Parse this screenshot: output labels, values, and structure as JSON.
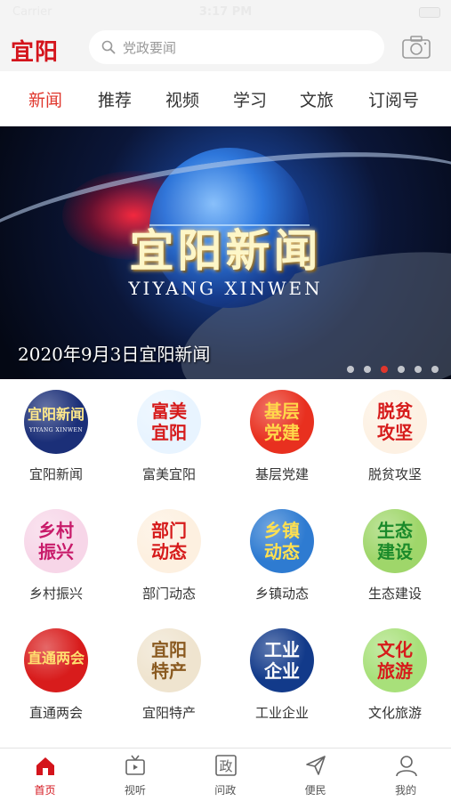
{
  "status_bar": {
    "carrier": "Carrier",
    "time": "3:17 PM"
  },
  "header": {
    "logo": "宜阳",
    "search_placeholder": "党政要闻",
    "search_icon": "search-icon",
    "camera_icon": "camera-icon"
  },
  "tabs": [
    {
      "label": "新闻",
      "active": true
    },
    {
      "label": "推荐"
    },
    {
      "label": "视频"
    },
    {
      "label": "学习"
    },
    {
      "label": "文旅"
    },
    {
      "label": "订阅号"
    }
  ],
  "banner": {
    "title": "宜阳新闻",
    "subtitle": "YIYANG XINWEN",
    "caption": "2020年9月3日宜阳新闻",
    "slide_count": 6,
    "active_slide": 2
  },
  "grid": [
    {
      "label": "宜阳新闻",
      "icon_text": "宜阳新闻",
      "icon_sub": "YIYANG XINWEN",
      "bg": "#1b2f78",
      "fg": "#ffe98a"
    },
    {
      "label": "富美宜阳",
      "icon_text": "富美\n宜阳",
      "bg": "#e8f4ff",
      "fg": "#d61b1b"
    },
    {
      "label": "基层党建",
      "icon_text": "基层\n党建",
      "bg": "#e8301f",
      "fg": "#ffd84a"
    },
    {
      "label": "脱贫攻坚",
      "icon_text": "脱贫\n攻坚",
      "bg": "#fdf1e3",
      "fg": "#d61b1b"
    },
    {
      "label": "乡村振兴",
      "icon_text": "乡村\n振兴",
      "bg": "#f7d6e8",
      "fg": "#c81b6a"
    },
    {
      "label": "部门动态",
      "icon_text": "部门\n动态",
      "bg": "#fdf0e0",
      "fg": "#d61b1b"
    },
    {
      "label": "乡镇动态",
      "icon_text": "乡镇\n动态",
      "bg": "#2e7bd1",
      "fg": "#ffe050"
    },
    {
      "label": "生态建设",
      "icon_text": "生态\n建设",
      "bg": "#9fd66a",
      "fg": "#1a8a2a"
    },
    {
      "label": "直通两会",
      "icon_text": "直通两会",
      "bg": "#d81c1c",
      "fg": "#ffe070"
    },
    {
      "label": "宜阳特产",
      "icon_text": "宜阳\n特产",
      "bg": "#efe4cf",
      "fg": "#8a5a20"
    },
    {
      "label": "工业企业",
      "icon_text": "工业\n企业",
      "bg": "#123a8a",
      "fg": "#ffffff"
    },
    {
      "label": "文化旅游",
      "icon_text": "文化\n旅游",
      "bg": "#a8e07a",
      "fg": "#d61b1b"
    }
  ],
  "bottom_nav": [
    {
      "label": "首页",
      "icon": "home-icon",
      "active": true
    },
    {
      "label": "视听",
      "icon": "tv-icon"
    },
    {
      "label": "问政",
      "icon": "zheng-icon",
      "glyph": "政"
    },
    {
      "label": "便民",
      "icon": "send-icon"
    },
    {
      "label": "我的",
      "icon": "user-icon"
    }
  ],
  "colors": {
    "accent": "#d4141c",
    "tab_active": "#e0362c"
  }
}
